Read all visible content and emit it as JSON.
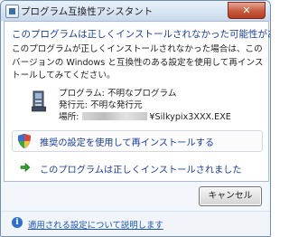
{
  "window": {
    "title": "プログラム互換性アシスタント",
    "close_label": "✕"
  },
  "content": {
    "heading": "このプログラムは正しくインストールされなかった可能性があります",
    "description": "このプログラムが正しくインストールされなかった場合は、このバージョンの Windows と互換性のある設定を使用して再インストールしてみてください。",
    "program": {
      "name_line": "プログラム: 不明なプログラム",
      "publisher_line": "発行元: 不明な発行元",
      "location_label": "場所:",
      "location_file": "¥Silkypix3XXX.EXE"
    },
    "options": [
      {
        "label": "推奨の設定を使用して再インストールする",
        "icon": "shield-icon"
      },
      {
        "label": "このプログラムは正しくインストールされました",
        "icon": "green-arrow-icon"
      }
    ]
  },
  "buttons": {
    "cancel": "キャンセル"
  },
  "footer": {
    "help_link": "適用される設定について説明します"
  },
  "colors": {
    "heading_blue": "#1a3d9a",
    "link_blue": "#1b55b0",
    "arrow_green": "#2e9e2e"
  }
}
